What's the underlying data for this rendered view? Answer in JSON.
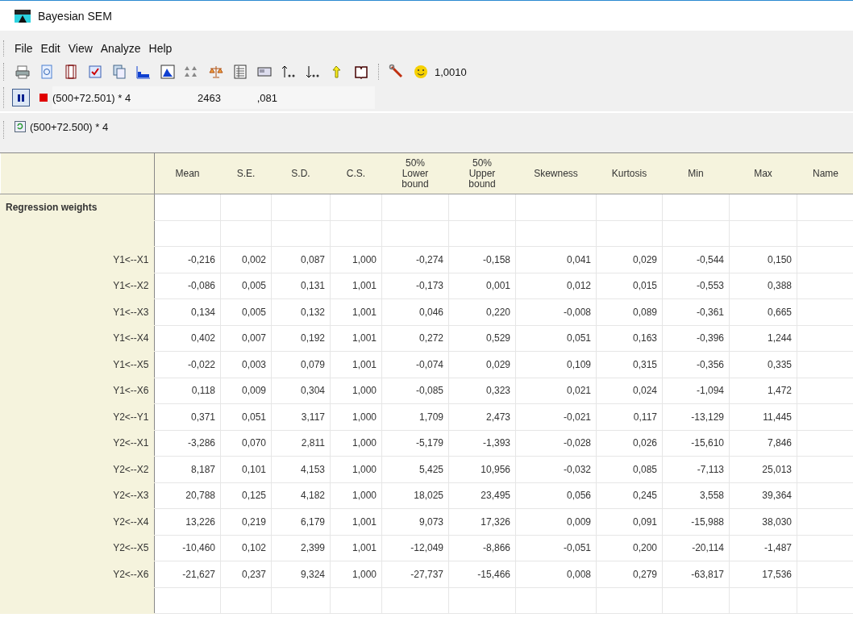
{
  "window": {
    "title": "Bayesian SEM"
  },
  "menu": [
    "File",
    "Edit",
    "View",
    "Analyze",
    "Help"
  ],
  "toolbar": {
    "reading": "1,0010"
  },
  "run_bar": {
    "paused": true,
    "formula": "(500+72.501) * 4",
    "count": "2463",
    "value": ",081"
  },
  "refresh_bar": {
    "formula": "(500+72.500) * 4"
  },
  "table": {
    "columns": [
      "Mean",
      "S.E.",
      "S.D.",
      "C.S.",
      "50%\nLower\nbound",
      "50%\nUpper\nbound",
      "Skewness",
      "Kurtosis",
      "Min",
      "Max",
      "Name"
    ],
    "sections": [
      {
        "title": "Regression weights",
        "rows": [
          {
            "label": "Y1<--X1",
            "values": [
              "-0,216",
              "0,002",
              "0,087",
              "1,000",
              "-0,274",
              "-0,158",
              "0,041",
              "0,029",
              "-0,544",
              "0,150"
            ]
          },
          {
            "label": "Y1<--X2",
            "values": [
              "-0,086",
              "0,005",
              "0,131",
              "1,001",
              "-0,173",
              "0,001",
              "0,012",
              "0,015",
              "-0,553",
              "0,388"
            ]
          },
          {
            "label": "Y1<--X3",
            "values": [
              "0,134",
              "0,005",
              "0,132",
              "1,001",
              "0,046",
              "0,220",
              "-0,008",
              "0,089",
              "-0,361",
              "0,665"
            ]
          },
          {
            "label": "Y1<--X4",
            "values": [
              "0,402",
              "0,007",
              "0,192",
              "1,001",
              "0,272",
              "0,529",
              "0,051",
              "0,163",
              "-0,396",
              "1,244"
            ]
          },
          {
            "label": "Y1<--X5",
            "values": [
              "-0,022",
              "0,003",
              "0,079",
              "1,001",
              "-0,074",
              "0,029",
              "0,109",
              "0,315",
              "-0,356",
              "0,335"
            ]
          },
          {
            "label": "Y1<--X6",
            "values": [
              "0,118",
              "0,009",
              "0,304",
              "1,000",
              "-0,085",
              "0,323",
              "0,021",
              "0,024",
              "-1,094",
              "1,472"
            ]
          },
          {
            "label": "Y2<--Y1",
            "values": [
              "0,371",
              "0,051",
              "3,117",
              "1,000",
              "1,709",
              "2,473",
              "-0,021",
              "0,117",
              "-13,129",
              "11,445"
            ]
          },
          {
            "label": "Y2<--X1",
            "values": [
              "-3,286",
              "0,070",
              "2,811",
              "1,000",
              "-5,179",
              "-1,393",
              "-0,028",
              "0,026",
              "-15,610",
              "7,846"
            ]
          },
          {
            "label": "Y2<--X2",
            "values": [
              "8,187",
              "0,101",
              "4,153",
              "1,000",
              "5,425",
              "10,956",
              "-0,032",
              "0,085",
              "-7,113",
              "25,013"
            ]
          },
          {
            "label": "Y2<--X3",
            "values": [
              "20,788",
              "0,125",
              "4,182",
              "1,000",
              "18,025",
              "23,495",
              "0,056",
              "0,245",
              "3,558",
              "39,364"
            ]
          },
          {
            "label": "Y2<--X4",
            "values": [
              "13,226",
              "0,219",
              "6,179",
              "1,001",
              "9,073",
              "17,326",
              "0,009",
              "0,091",
              "-15,988",
              "38,030"
            ]
          },
          {
            "label": "Y2<--X5",
            "values": [
              "-10,460",
              "0,102",
              "2,399",
              "1,001",
              "-12,049",
              "-8,866",
              "-0,051",
              "0,200",
              "-20,114",
              "-1,487"
            ]
          },
          {
            "label": "Y2<--X6",
            "values": [
              "-21,627",
              "0,237",
              "9,324",
              "1,000",
              "-27,737",
              "-15,466",
              "0,008",
              "0,279",
              "-63,817",
              "17,536"
            ]
          }
        ]
      }
    ]
  }
}
